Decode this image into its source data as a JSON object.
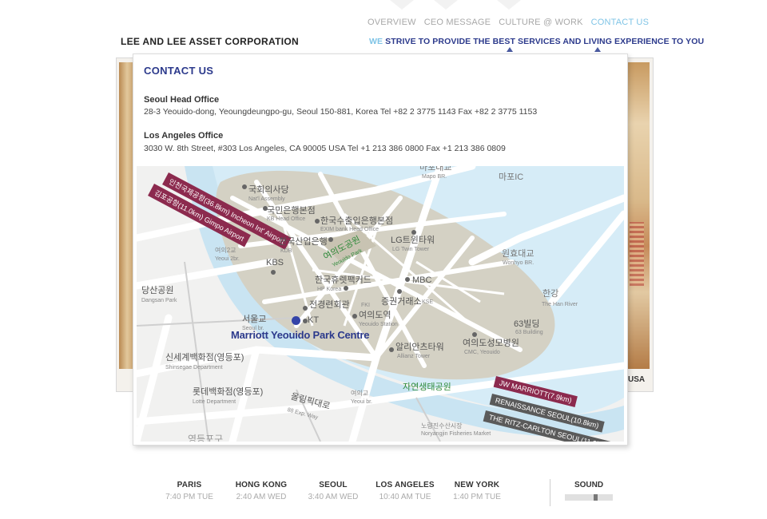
{
  "nav": {
    "items": [
      {
        "label": "OVERVIEW",
        "active": false
      },
      {
        "label": "CEO MESSAGE",
        "active": false
      },
      {
        "label": "CULTURE @ WORK",
        "active": false
      },
      {
        "label": "CONTACT US",
        "active": true
      }
    ]
  },
  "brand": "LEE AND LEE ASSET CORPORATION",
  "tagline": {
    "we": "WE",
    "rest": " STRIVE TO PROVIDE THE BEST SERVICES AND LIVING EXPERIENCE TO YOU"
  },
  "bg": {
    "partial_label": "USA"
  },
  "panel": {
    "title": "CONTACT US",
    "offices": [
      {
        "name": "Seoul Head Office",
        "address": "28-3 Yeouido-dong, Yeoungdeungpo-gu, Seoul 150-881, Korea   Tel +82 2 3775 1143   Fax +82 2 3775 1153"
      },
      {
        "name": "Los Angeles Office",
        "address": "3030 W. 8th Street, #303 Los Angeles,  CA  90005  USA  Tel  +1 213 386 0800   Fax +1 213 386 0809"
      }
    ]
  },
  "map": {
    "landmarks": [
      {
        "ko": "국회의사당",
        "en": "Nat'l Assembly"
      },
      {
        "ko": "국민은행본점",
        "en": "KB Head Office"
      },
      {
        "ko": "한국수출입은행본점",
        "en": "EXIM bank Head Office"
      },
      {
        "ko": "한국산업은행",
        "en": "KDB"
      },
      {
        "ko": "LG트윈타워",
        "en": "LG Twin Tower"
      },
      {
        "ko": "KBS",
        "en": ""
      },
      {
        "ko": "한국휴렛팩커드",
        "en": "HP Korea"
      },
      {
        "ko": "MBC",
        "en": ""
      },
      {
        "ko": "전경련회관",
        "en": "FKI"
      },
      {
        "ko": "증권거래소",
        "en": "KSE"
      },
      {
        "ko": "여의도역",
        "en": "Yeouido Station"
      },
      {
        "ko": "KT",
        "en": ""
      },
      {
        "ko": "63빌딩",
        "en": "63 Building"
      },
      {
        "ko": "알리안츠타워",
        "en": "Allianz Tower"
      },
      {
        "ko": "여의도성모병원",
        "en": "CMC, Yeouido"
      }
    ],
    "park": {
      "ko": "여의도공원",
      "en": "Yeouido Park"
    },
    "eco_park": "자연생태공원",
    "places": [
      {
        "ko": "마포대교",
        "en": "Mapo BR."
      },
      {
        "ko": "마포IC",
        "en": ""
      },
      {
        "ko": "원효대교",
        "en": "Wonhyo BR."
      },
      {
        "ko": "한강",
        "en": "The Han River"
      },
      {
        "ko": "여의2교",
        "en": "Yeoui 2br."
      },
      {
        "ko": "당산공원",
        "en": "Dangsan Park"
      },
      {
        "ko": "서울교",
        "en": "Seoul br."
      },
      {
        "ko": "신세계백화점(영등포)",
        "en": "Shinsegae Department"
      },
      {
        "ko": "롯데백화점(영등포)",
        "en": "Lotte Department"
      },
      {
        "ko": "올림픽대로",
        "en": "88 Exp. Way"
      },
      {
        "ko": "여의교",
        "en": "Yeoui br."
      },
      {
        "ko": "노량진수산시장",
        "en": "Noryangjin Fisheries Market"
      },
      {
        "ko": "영등포구",
        "en": ""
      }
    ],
    "main_location": "Marriott Yeouido Park Centre",
    "airports": [
      {
        "label": "인천국제공항(36.8km) Incheon Int' Airport"
      },
      {
        "label": "김포공항(11.0km) Gimpo Airport"
      }
    ],
    "hotels": [
      {
        "label": "JW MARRIOTT(7.9km)"
      },
      {
        "label": "RENAISSANCE SEOUL(10.8km)"
      },
      {
        "label": "THE RITZ-CARLTON SEOUL(11.9km)"
      }
    ],
    "colors": {
      "water": "#d6ecf7",
      "island": "#d4d1c4",
      "road": "#ffffff",
      "main": "#3444a8",
      "airport_tag": "#8c2a4e",
      "hotel_tag": "#5a5a5a"
    }
  },
  "clocks": [
    {
      "city": "PARIS",
      "time": "7:40 PM TUE"
    },
    {
      "city": "HONG KONG",
      "time": "2:40 AM WED"
    },
    {
      "city": "SEOUL",
      "time": "3:40 AM WED"
    },
    {
      "city": "LOS ANGELES",
      "time": "10:40 AM TUE"
    },
    {
      "city": "NEW YORK",
      "time": "1:40 PM TUE"
    }
  ],
  "sound": {
    "label": "SOUND",
    "level": 0.65
  }
}
